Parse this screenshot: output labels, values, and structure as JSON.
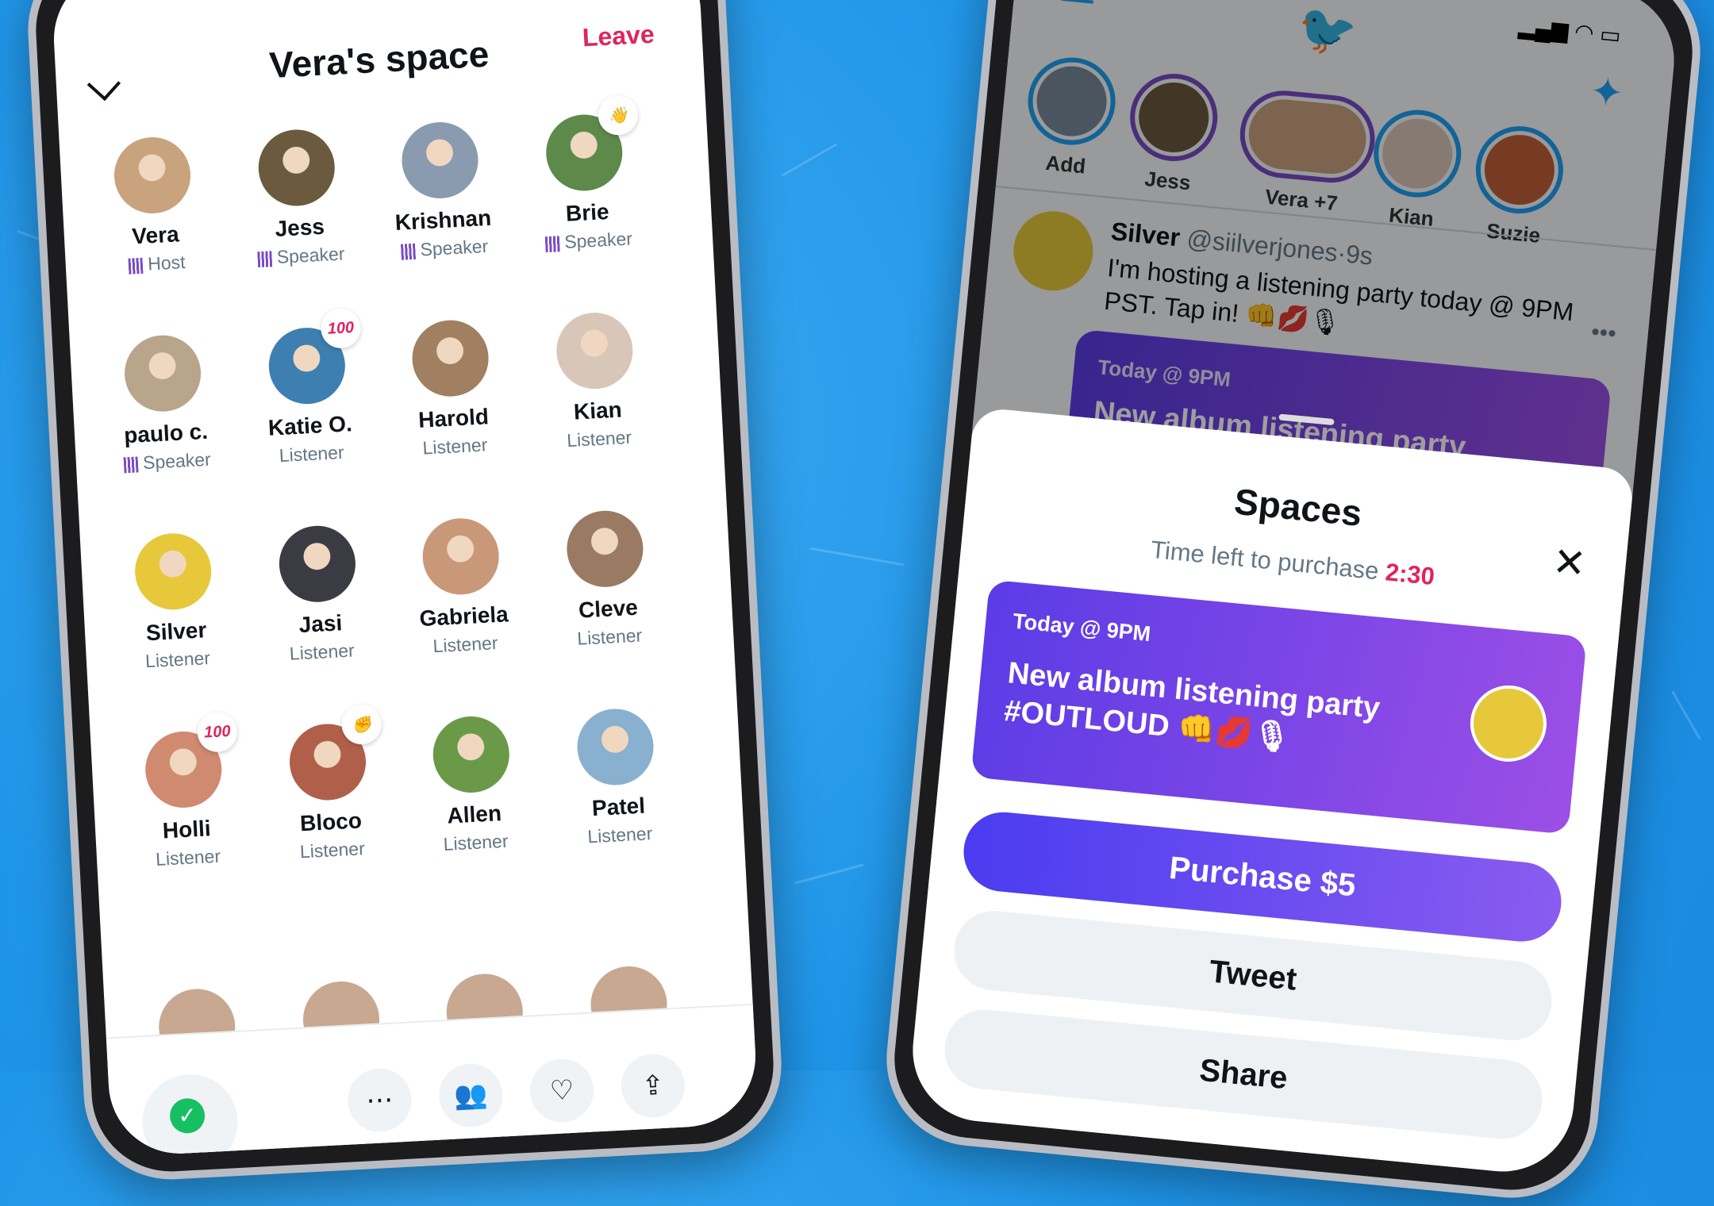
{
  "colors": {
    "accent": "#e0245e",
    "twitter_blue": "#1da1f2",
    "purple": "#794bc4",
    "background": "#1f95e8"
  },
  "left_phone": {
    "title": "Vera's space",
    "leave_label": "Leave",
    "collapse_icon": "chevron-down-icon",
    "participants": [
      {
        "name": "Vera",
        "role": "Host",
        "speaking": true,
        "color": "#c9a27e"
      },
      {
        "name": "Jess",
        "role": "Speaker",
        "speaking": true,
        "color": "#6b5a3e"
      },
      {
        "name": "Krishnan",
        "role": "Speaker",
        "speaking": true,
        "color": "#8a9bb0"
      },
      {
        "name": "Brie",
        "role": "Speaker",
        "speaking": true,
        "color": "#5d8a4a",
        "badge": "wave-emoji"
      },
      {
        "name": "paulo c.",
        "role": "Speaker",
        "speaking": true,
        "color": "#b9a58a"
      },
      {
        "name": "Katie O.",
        "role": "Listener",
        "speaking": false,
        "color": "#3d7fb0",
        "badge": "hundred-emoji"
      },
      {
        "name": "Harold",
        "role": "Listener",
        "speaking": false,
        "color": "#a08060"
      },
      {
        "name": "Kian",
        "role": "Listener",
        "speaking": false,
        "color": "#d8c6b8"
      },
      {
        "name": "Silver",
        "role": "Listener",
        "speaking": false,
        "color": "#e6c83a"
      },
      {
        "name": "Jasi",
        "role": "Listener",
        "speaking": false,
        "color": "#3b3b44"
      },
      {
        "name": "Gabriela",
        "role": "Listener",
        "speaking": false,
        "color": "#c89878"
      },
      {
        "name": "Cleve",
        "role": "Listener",
        "speaking": false,
        "color": "#9a7a62"
      },
      {
        "name": "Holli",
        "role": "Listener",
        "speaking": false,
        "color": "#d08a70",
        "badge": "hundred-emoji"
      },
      {
        "name": "Bloco",
        "role": "Listener",
        "speaking": false,
        "color": "#b0604a",
        "badge": "fist-emoji"
      },
      {
        "name": "Allen",
        "role": "Listener",
        "speaking": false,
        "color": "#6a9a48"
      },
      {
        "name": "Patel",
        "role": "Listener",
        "speaking": false,
        "color": "#8ab0d0"
      }
    ],
    "badge_text": {
      "hundred-emoji": "100",
      "wave-emoji": "👋",
      "fist-emoji": "✊"
    },
    "bottom_icons": [
      "mic-check-icon",
      "more-icon",
      "people-icon",
      "heart-plus-icon",
      "share-icon"
    ]
  },
  "right_phone": {
    "stories": [
      {
        "name": "Add",
        "color": "#7a8a9a"
      },
      {
        "name": "Jess",
        "color": "#6b5a3e"
      },
      {
        "name": "Vera +7",
        "color": "#c9a27e"
      },
      {
        "name": "Kian",
        "color": "#d8c6b8"
      },
      {
        "name": "Suzie",
        "color": "#c0603a"
      }
    ],
    "tweet": {
      "name": "Silver",
      "handle": "@siilverjones",
      "time": "9s",
      "text": "I'm hosting a listening party today @ 9PM PST. Tap in!",
      "emojis": "👊💋🎙"
    },
    "bg_card": {
      "time": "Today @ 9PM",
      "title": "New album listening party #OUTLOUD"
    },
    "sheet": {
      "title": "Spaces",
      "timer_label": "Time left to purchase",
      "timer_value": "2:30",
      "card_time": "Today @ 9PM",
      "card_title": "New album listening party #OUTLOUD",
      "card_emojis": "👊💋🎙",
      "purchase_label": "Purchase $5",
      "tweet_label": "Tweet",
      "share_label": "Share"
    }
  }
}
